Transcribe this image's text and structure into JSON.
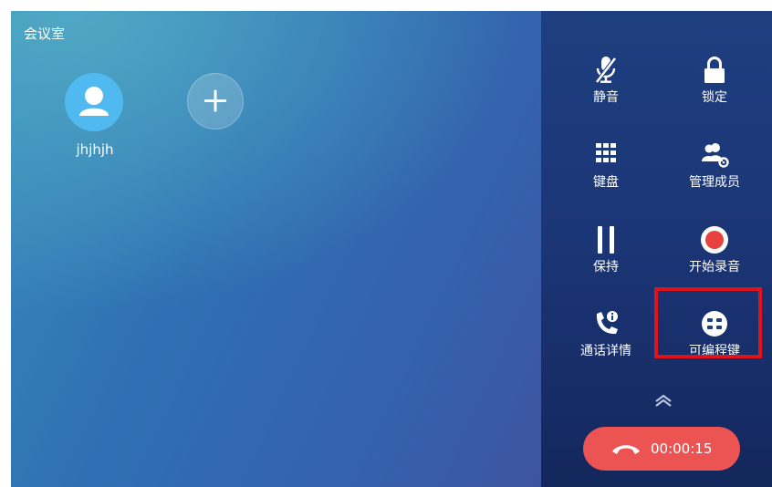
{
  "conference": {
    "title": "会议室"
  },
  "participants": [
    {
      "name": "jhjhjh"
    }
  ],
  "controls": {
    "mute": "静音",
    "lock": "锁定",
    "keypad": "键盘",
    "manage_members": "管理成员",
    "hold": "保持",
    "start_recording": "开始录音",
    "call_details": "通话详情",
    "programmable_keys": "可编程键"
  },
  "end_call": {
    "duration": "00:00:15"
  },
  "colors": {
    "end_call": "#ec5353",
    "record_dot": "#e8423f",
    "avatar": "#4fb9f0",
    "highlight_box": "#e0121a"
  }
}
